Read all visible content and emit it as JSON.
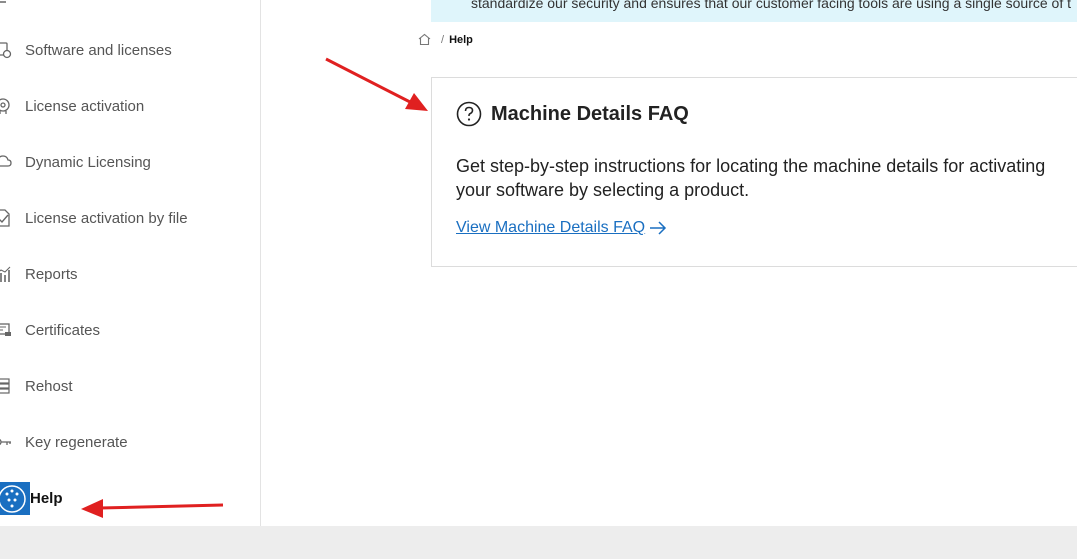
{
  "sidebar": {
    "items": [
      {
        "label": "Software and licenses",
        "icon": "software-license-icon"
      },
      {
        "label": "License activation",
        "icon": "license-activation-icon"
      },
      {
        "label": "Dynamic Licensing",
        "icon": "cloud-icon"
      },
      {
        "label": "License activation by file",
        "icon": "file-check-icon"
      },
      {
        "label": "Reports",
        "icon": "chart-icon"
      },
      {
        "label": "Certificates",
        "icon": "certificate-icon"
      },
      {
        "label": "Rehost",
        "icon": "rehost-icon"
      },
      {
        "label": "Key regenerate",
        "icon": "key-icon"
      },
      {
        "label": "Help",
        "icon": "help-icon",
        "active": true
      }
    ]
  },
  "banner": {
    "text": "standardize our security and ensures that our customer facing tools are using a single source of t"
  },
  "breadcrumb": {
    "separator": "/",
    "current": "Help"
  },
  "faq_card": {
    "title": "Machine Details FAQ",
    "description": "Get step-by-step instructions for locating the machine details for activating your software by selecting a product.",
    "link_label": "View Machine Details FAQ"
  },
  "colors": {
    "accent": "#1a6fc1",
    "banner_bg": "#dff5fb",
    "annotation_arrow": "#e02020"
  }
}
